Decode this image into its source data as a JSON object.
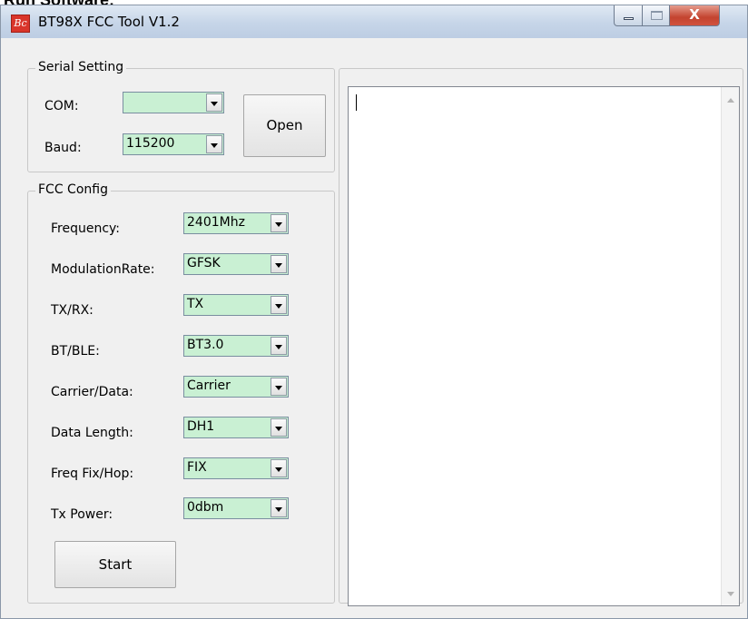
{
  "page_heading": "Run Software:",
  "window": {
    "title": "BT98X FCC Tool V1.2",
    "icon_text": "Bc",
    "close_glyph": "X"
  },
  "serial_setting": {
    "legend": "Serial Setting",
    "com_label": "COM:",
    "com_value": "",
    "baud_label": "Baud:",
    "baud_value": "115200",
    "open_button": "Open"
  },
  "fcc_config": {
    "legend": "FCC Config",
    "fields": [
      {
        "label": "Frequency:",
        "value": "2401Mhz"
      },
      {
        "label": "ModulationRate:",
        "value": "GFSK"
      },
      {
        "label": "TX/RX:",
        "value": "TX"
      },
      {
        "label": "BT/BLE:",
        "value": "BT3.0"
      },
      {
        "label": "Carrier/Data:",
        "value": "Carrier"
      },
      {
        "label": "Data Length:",
        "value": "DH1"
      },
      {
        "label": "Freq Fix/Hop:",
        "value": "FIX"
      },
      {
        "label": "Tx Power:",
        "value": "0dbm"
      }
    ],
    "start_button": "Start"
  },
  "log_output": {
    "text": ""
  },
  "colors": {
    "combo_fill": "#c9f0d3",
    "title_gradient_top": "#dfe8f3",
    "close_button": "#c3432f"
  }
}
